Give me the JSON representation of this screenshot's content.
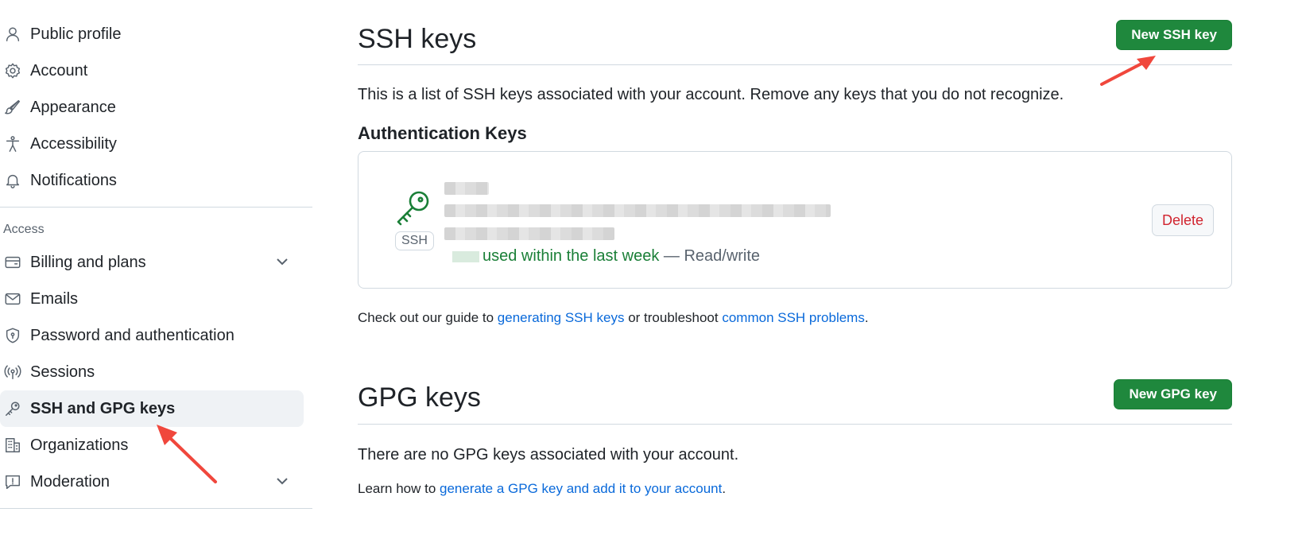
{
  "sidebar": {
    "items_top": [
      {
        "label": "Public profile",
        "icon": "person-icon"
      },
      {
        "label": "Account",
        "icon": "gear-icon"
      },
      {
        "label": "Appearance",
        "icon": "paintbrush-icon"
      },
      {
        "label": "Accessibility",
        "icon": "accessibility-icon"
      },
      {
        "label": "Notifications",
        "icon": "bell-icon"
      }
    ],
    "access_label": "Access",
    "items_access": [
      {
        "label": "Billing and plans",
        "icon": "credit-card-icon"
      },
      {
        "label": "Emails",
        "icon": "mail-icon"
      },
      {
        "label": "Password and authentication",
        "icon": "shield-lock-icon"
      },
      {
        "label": "Sessions",
        "icon": "broadcast-icon"
      },
      {
        "label": "SSH and GPG keys",
        "icon": "key-icon"
      },
      {
        "label": "Organizations",
        "icon": "organization-icon"
      },
      {
        "label": "Moderation",
        "icon": "report-icon"
      }
    ]
  },
  "ssh": {
    "title": "SSH keys",
    "new_button": "New SSH key",
    "description": "This is a list of SSH keys associated with your account. Remove any keys that you do not recognize.",
    "auth_heading": "Authentication Keys",
    "key": {
      "type_label": "SSH",
      "usage_green": "used within the last week",
      "usage_suffix": " — Read/write",
      "delete_label": "Delete"
    },
    "help_prefix": "Check out our guide to ",
    "help_link1": "generating SSH keys",
    "help_middle": " or troubleshoot ",
    "help_link2": "common SSH problems",
    "help_suffix": "."
  },
  "gpg": {
    "title": "GPG keys",
    "new_button": "New GPG key",
    "empty_text": "There are no GPG keys associated with your account.",
    "learn_prefix": "Learn how to ",
    "learn_link": "generate a GPG key and add it to your account",
    "learn_suffix": "."
  },
  "colors": {
    "primary_button": "#1f883d",
    "link": "#0969da",
    "danger": "#d1242f",
    "annotation_arrow": "#f0473c"
  }
}
